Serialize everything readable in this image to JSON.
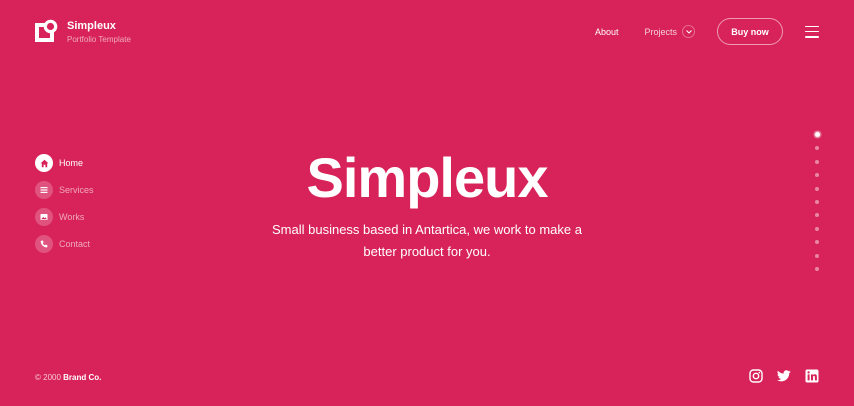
{
  "brand": {
    "name": "Simpleux",
    "tagline": "Portfolio Template",
    "logo_icon": "brand-logo-icon"
  },
  "nav": {
    "about_label": "About",
    "projects_label": "Projects",
    "buy_label": "Buy now",
    "menu_icon": "hamburger-menu-icon"
  },
  "sidenav": {
    "items": [
      {
        "label": "Home",
        "icon": "home-icon",
        "active": true
      },
      {
        "label": "Services",
        "icon": "list-icon",
        "active": false
      },
      {
        "label": "Works",
        "icon": "image-icon",
        "active": false
      },
      {
        "label": "Contact",
        "icon": "phone-icon",
        "active": false
      }
    ]
  },
  "hero": {
    "title": "Simpleux",
    "subtitle_line1": "Small business based in Antartica, we work to make a",
    "subtitle_line2": "better product for you."
  },
  "pagination": {
    "total": 11,
    "active_index": 0
  },
  "footer": {
    "copyright_prefix": "© 2000 ",
    "copyright_brand": "Brand Co.",
    "social": [
      "instagram-icon",
      "twitter-icon",
      "linkedin-icon"
    ]
  },
  "colors": {
    "background": "#d8235a",
    "foreground": "#ffffff"
  }
}
